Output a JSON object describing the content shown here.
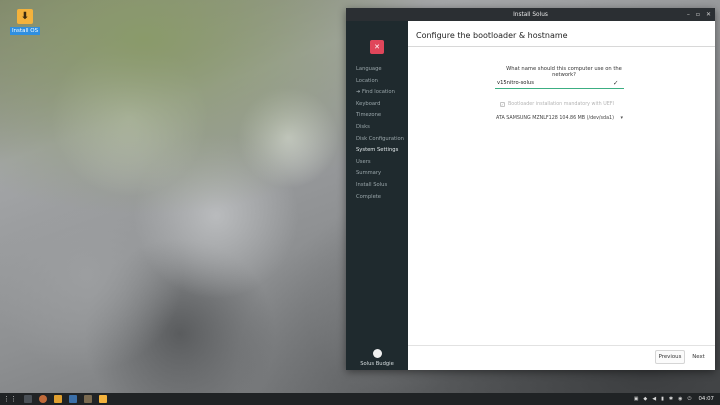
{
  "desktop": {
    "icon_label": "Install OS"
  },
  "window": {
    "title": "Install Solus",
    "controls": {
      "minimize": "–",
      "maximize": "▫",
      "close": "✕"
    }
  },
  "sidebar": {
    "items": [
      {
        "label": "Language"
      },
      {
        "label": "Location"
      },
      {
        "label": "➜ Find location"
      },
      {
        "label": "Keyboard"
      },
      {
        "label": "Timezone"
      },
      {
        "label": "Disks"
      },
      {
        "label": "Disk Configuration"
      },
      {
        "label": "System Settings"
      },
      {
        "label": "Users"
      },
      {
        "label": "Summary"
      },
      {
        "label": "Install Solus"
      },
      {
        "label": "Complete"
      }
    ],
    "active_index": 7,
    "brand": "Solus Budgie"
  },
  "main": {
    "title": "Configure the bootloader & hostname",
    "question": "What name should this computer use on the network?",
    "hostname_value": "v15nitro-solus",
    "bootloader_label": "Bootloader installation mandatory with UEFI",
    "disk_selected": "ATA SAMSUNG MZNLF128 104.86 MB (/dev/sda1)",
    "prev_label": "Previous",
    "next_label": "Next"
  },
  "panel": {
    "clock": "04:07"
  },
  "colors": {
    "accent": "#3cae82",
    "sidebar_bg": "#1f2a2e",
    "logo_red": "#e0465a"
  }
}
